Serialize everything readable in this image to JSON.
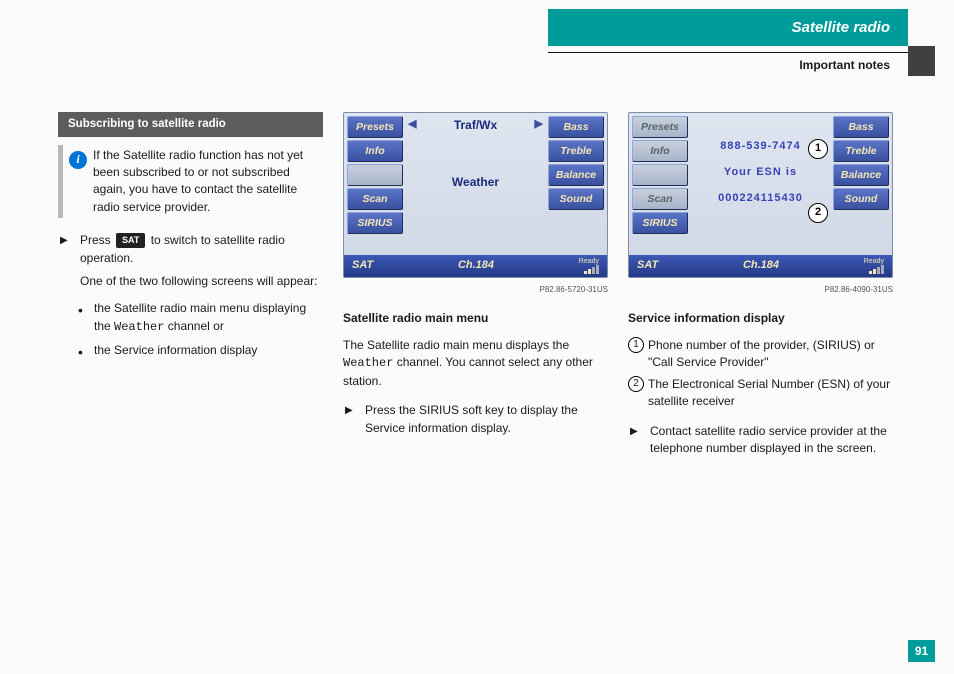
{
  "header": {
    "title": "Satellite radio",
    "subtitle": "Important notes"
  },
  "page_number": "91",
  "col1": {
    "section_title": "Subscribing to satellite radio",
    "info_note": "If the Satellite radio function has not yet been subscribed to or not subscribed again, you have to contact the satellite radio service provider.",
    "step1_a": "Press ",
    "step1_key": "SAT",
    "step1_b": " to switch to satellite radio operation.",
    "after1": "One of the two following screens will appear:",
    "bullets": {
      "b1_a": "the Satellite radio main menu displaying the ",
      "b1_mono": "Weather",
      "b1_b": " channel or",
      "b2": "the Service information display"
    }
  },
  "col2": {
    "img_ref": "P82.86-5720-31US",
    "heading": "Satellite radio main menu",
    "para_a": "The Satellite radio main menu displays the ",
    "para_mono": "Weather",
    "para_b": " channel. You cannot select any other station.",
    "step": "Press the SIRIUS soft key to display the Service information display."
  },
  "col3": {
    "img_ref": "P82.86-4090-31US",
    "heading": "Service information display",
    "legend1": "Phone number of the provider, (SIRIUS) or \"Call Service Provider\"",
    "legend2": "The Electronical Serial Number (ESN) of your satellite receiver",
    "step": "Contact satellite radio service provider at the telephone number displayed in the screen."
  },
  "device": {
    "left_btns": [
      "Presets",
      "Info",
      "",
      "Scan",
      "SIRIUS"
    ],
    "right_btns": [
      "Bass",
      "Treble",
      "Balance",
      "Sound"
    ],
    "traf": "Traf/Wx",
    "weather": "Weather",
    "sat": "SAT",
    "ch": "Ch.184",
    "ready": "Ready",
    "svc_phone": "888-539-7474",
    "svc_esn_label": "Your ESN is",
    "svc_esn": "000224115430"
  }
}
